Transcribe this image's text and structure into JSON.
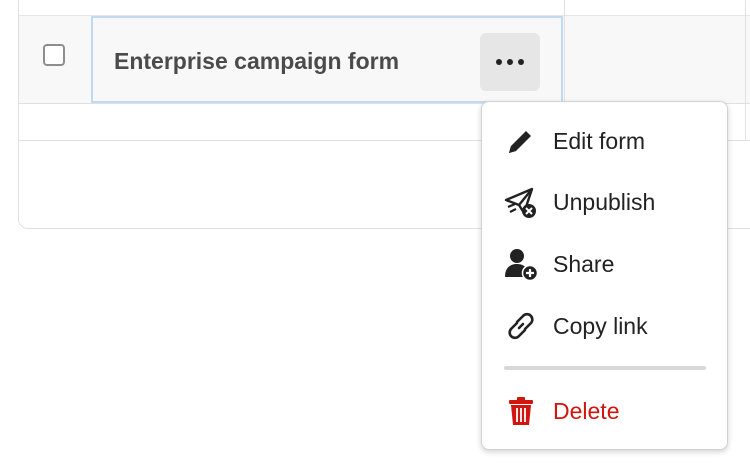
{
  "table": {
    "row": {
      "name": "Enterprise campaign form",
      "checked": false,
      "more_icon": "more-horizontal-icon"
    }
  },
  "menu": {
    "items": [
      {
        "label": "Edit form",
        "icon": "pencil-icon"
      },
      {
        "label": "Unpublish",
        "icon": "unpublish-icon"
      },
      {
        "label": "Share",
        "icon": "user-add-icon"
      },
      {
        "label": "Copy link",
        "icon": "link-icon"
      }
    ],
    "danger_item": {
      "label": "Delete",
      "icon": "trash-icon"
    }
  },
  "colors": {
    "danger": "#d31510",
    "selected_outline": "#c0d9f5",
    "text": "#222222"
  }
}
